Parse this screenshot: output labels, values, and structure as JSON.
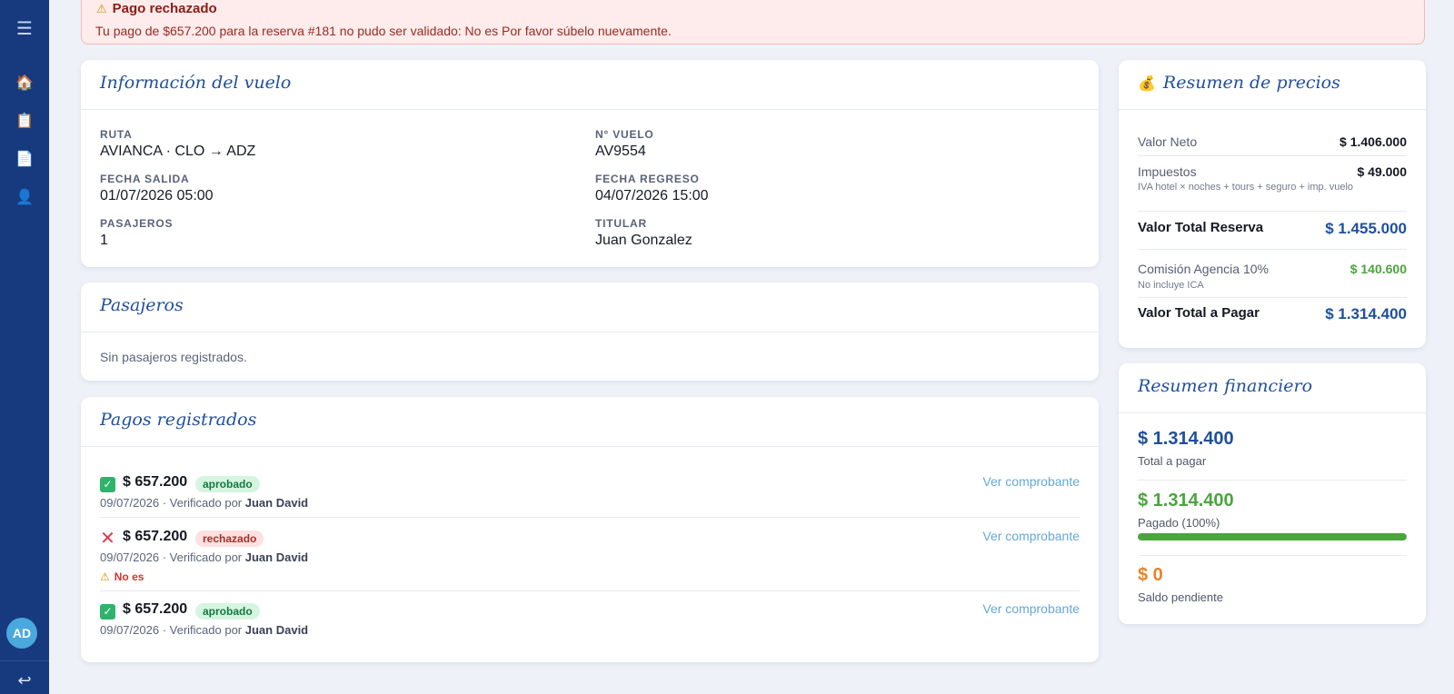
{
  "sidebar": {
    "menu_icon": "☰",
    "items": [
      {
        "name": "home-icon",
        "glyph": "🏠"
      },
      {
        "name": "reservations-icon",
        "glyph": "📋"
      },
      {
        "name": "documents-icon",
        "glyph": "📄"
      },
      {
        "name": "user-icon",
        "glyph": "👤"
      }
    ],
    "avatar_initials": "AD",
    "logout_icon": "↩"
  },
  "alert": {
    "title": "Pago rechazado",
    "message": "Tu pago de $657.200 para la reserva #181 no pudo ser validado: No es Por favor súbelo nuevamente."
  },
  "flight": {
    "title": "Información del vuelo",
    "fields": [
      {
        "label": "RUTA",
        "value": "AVIANCA · CLO → ADZ"
      },
      {
        "label": "N° VUELO",
        "value": "AV9554"
      },
      {
        "label": "FECHA SALIDA",
        "value": "01/07/2026 05:00"
      },
      {
        "label": "FECHA REGRESO",
        "value": "04/07/2026 15:00"
      },
      {
        "label": "PASAJEROS",
        "value": "1"
      },
      {
        "label": "TITULAR",
        "value": "Juan Gonzalez"
      }
    ]
  },
  "passengers": {
    "title": "Pasajeros",
    "empty_text": "Sin pasajeros registrados."
  },
  "payments": {
    "title": "Pagos registrados",
    "link_label": "Ver comprobante",
    "verified_prefix": "Verificado por",
    "items": [
      {
        "status": "approved",
        "amount": "$ 657.200",
        "badge": "aprobado",
        "date": "09/07/2026",
        "verifier": "Juan David",
        "reason": ""
      },
      {
        "status": "rejected",
        "amount": "$ 657.200",
        "badge": "rechazado",
        "date": "09/07/2026",
        "verifier": "Juan David",
        "reason": "No es"
      },
      {
        "status": "approved",
        "amount": "$ 657.200",
        "badge": "aprobado",
        "date": "09/07/2026",
        "verifier": "Juan David",
        "reason": ""
      }
    ]
  },
  "prices": {
    "title": "Resumen de precios",
    "title_icon": "💰",
    "net_label": "Valor Neto",
    "net_value": "$ 1.406.000",
    "tax_label": "Impuestos",
    "tax_value": "$ 49.000",
    "tax_note": "IVA hotel × noches + tours + seguro + imp. vuelo",
    "total_label": "Valor Total Reserva",
    "total_value": "$ 1.455.000",
    "commission_label": "Comisión Agencia 10%",
    "commission_value": "$ 140.600",
    "commission_note": "No incluye ICA",
    "pay_label": "Valor Total a Pagar",
    "pay_value": "$ 1.314.400"
  },
  "financial": {
    "title": "Resumen financiero",
    "total_amount": "$ 1.314.400",
    "total_label": "Total a pagar",
    "paid_amount": "$ 1.314.400",
    "paid_label": "Pagado (100%)",
    "paid_fraction": 1.0,
    "pending_amount": "$ 0",
    "pending_label": "Saldo pendiente"
  },
  "colors": {
    "sidebar": "#163a7d",
    "accent_blue": "#1f4f9c",
    "success_green": "#4aa53c",
    "pending_orange": "#e8832a",
    "link": "#64a8d8"
  }
}
